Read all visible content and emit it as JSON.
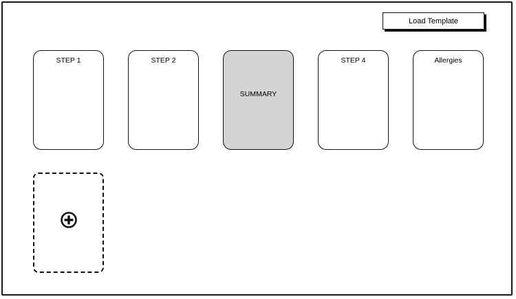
{
  "toolbar": {
    "load_template_label": "Load Template"
  },
  "cards": [
    {
      "label": "STEP 1",
      "selected": false
    },
    {
      "label": "STEP 2",
      "selected": false
    },
    {
      "label": "SUMMARY",
      "selected": true
    },
    {
      "label": "STEP 4",
      "selected": false
    },
    {
      "label": "Allergies",
      "selected": false
    }
  ],
  "add_card": {
    "icon": "plus-circle-icon"
  },
  "colors": {
    "border": "#111111",
    "selected_fill": "#d4d4d4",
    "background": "#ffffff"
  }
}
